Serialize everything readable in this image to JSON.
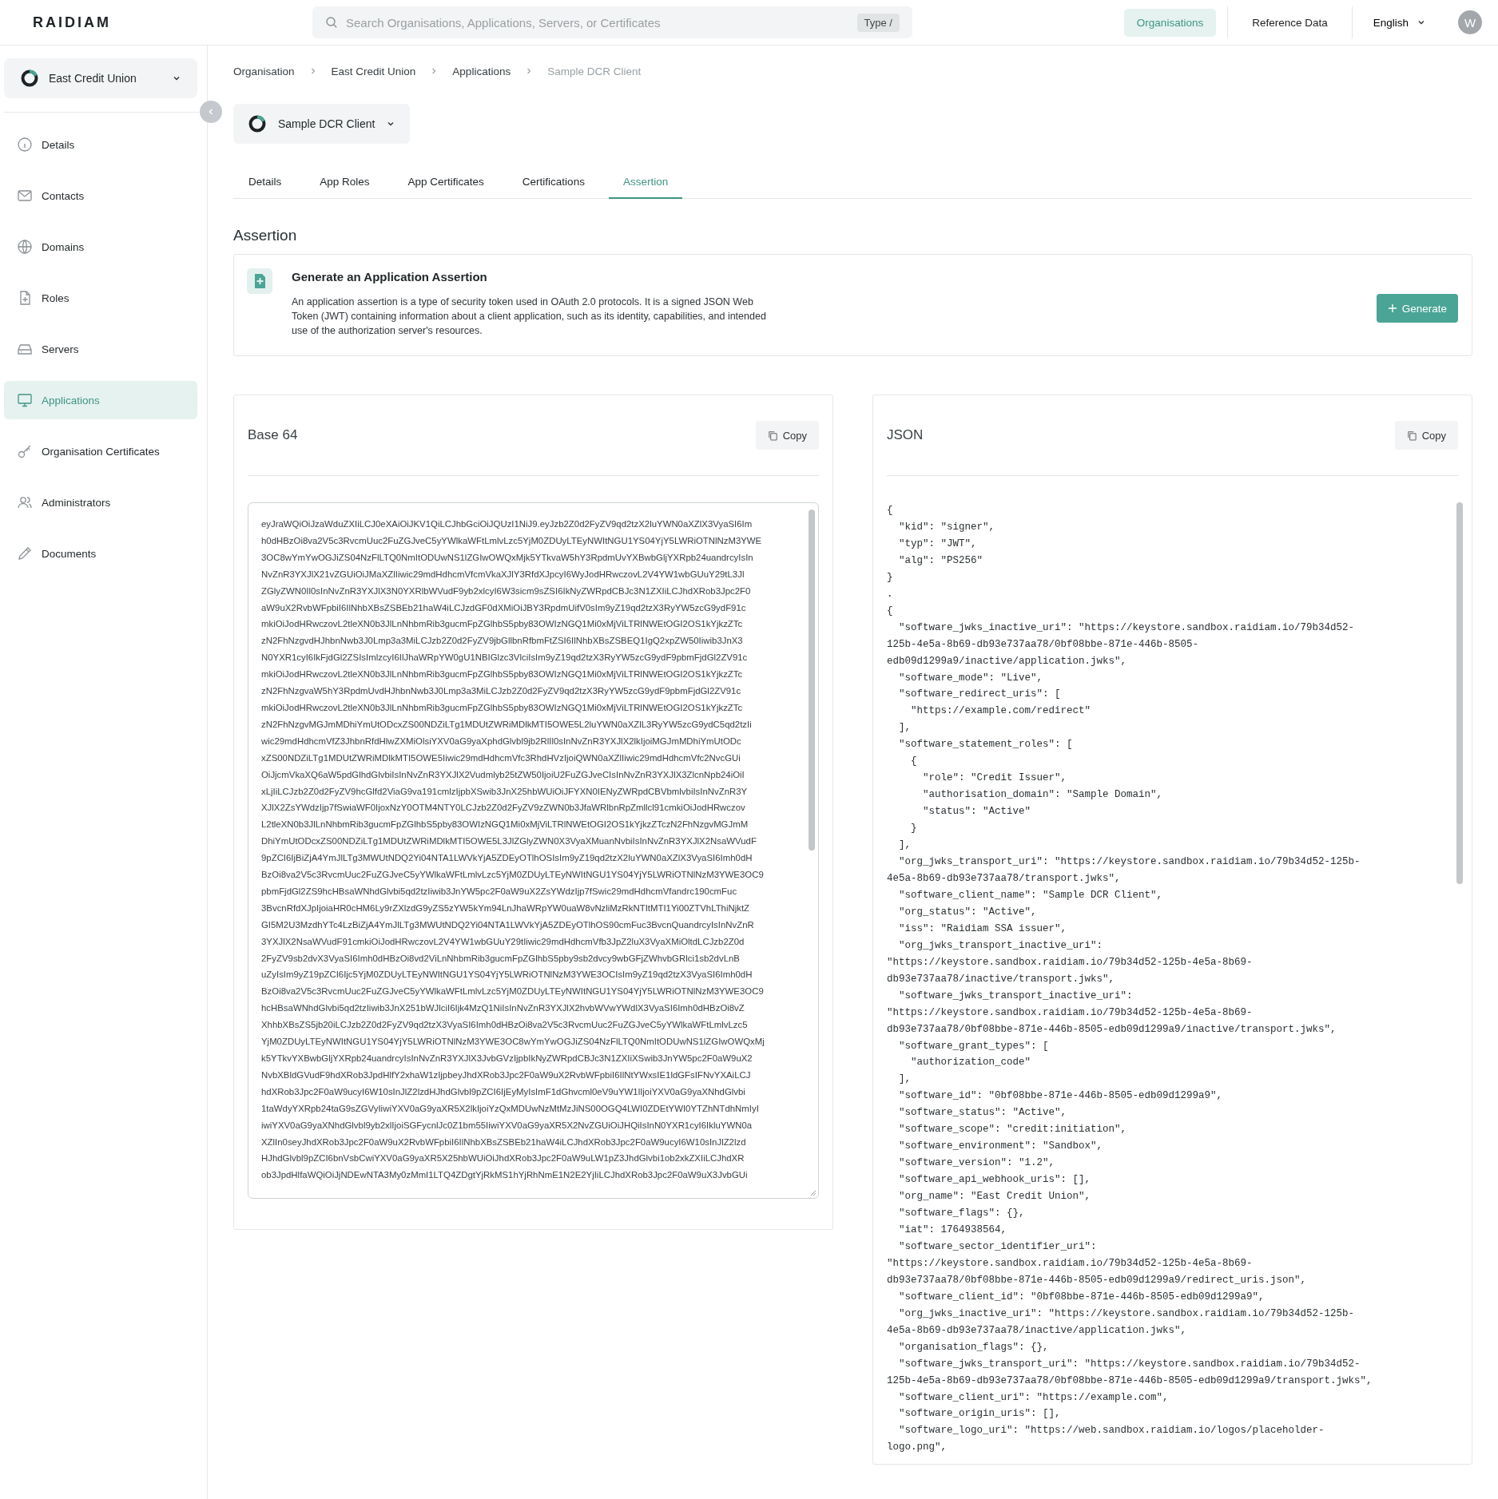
{
  "header": {
    "logo": "RAIDIAM",
    "search": {
      "placeholder": "Search Organisations, Applications, Servers, or Certificates",
      "shortcut": "Type /"
    },
    "nav": [
      {
        "label": "Organisations",
        "selected": true
      },
      {
        "label": "Reference Data",
        "selected": false
      }
    ],
    "language": "English",
    "avatar": "W"
  },
  "sidebar": {
    "organisation": "East Credit Union",
    "items": [
      {
        "label": "Details",
        "selected": false
      },
      {
        "label": "Contacts",
        "selected": false
      },
      {
        "label": "Domains",
        "selected": false
      },
      {
        "label": "Roles",
        "selected": false
      },
      {
        "label": "Servers",
        "selected": false
      },
      {
        "label": "Applications",
        "selected": true
      },
      {
        "label": "Organisation Certificates",
        "selected": false
      },
      {
        "label": "Administrators",
        "selected": false
      },
      {
        "label": "Documents",
        "selected": false
      }
    ]
  },
  "breadcrumb": [
    "Organisation",
    "East Credit Union",
    "Applications",
    "Sample DCR Client"
  ],
  "application": "Sample DCR Client",
  "tabs": [
    {
      "label": "Details",
      "selected": false
    },
    {
      "label": "App Roles",
      "selected": false
    },
    {
      "label": "App Certificates",
      "selected": false
    },
    {
      "label": "Certifications",
      "selected": false
    },
    {
      "label": "Assertion",
      "selected": true
    }
  ],
  "section_title": "Assertion",
  "generate_card": {
    "title": "Generate an Application Assertion",
    "description": "An application assertion is a type of security token used in OAuth 2.0 protocols. It is a signed JSON Web Token (JWT) containing information about a client application, such as its identity, capabilities, and intended use of the authorization server's resources.",
    "button": "Generate"
  },
  "base64_panel": {
    "title": "Base 64",
    "copy": "Copy",
    "lines": [
      "eyJraWQiOiJzaWduZXIiLCJ0eXAiOiJKV1QiLCJhbGciOiJQUzI1NiJ9.eyJzb2Z0d2FyZV9qd2tzX2luYWN0aXZlX3VyaSI6Im",
      "h0dHBzOi8va2V5c3RvcmUuc2FuZGJveC5yYWlkaWFtLmlvLzc5YjM0ZDUyLTEyNWItNGU1YS04YjY5LWRiOTNlNzM3YWE",
      "3OC8wYmYwOGJiZS04NzFlLTQ0NmItODUwNS1lZGIwOWQxMjk5YTkvaW5hY3RpdmUvYXBwbGljYXRpb24uandrcyIsIn",
      "NvZnR3YXJlX21vZGUiOiJMaXZlIiwic29mdHdhcmVfcmVkaXJlY3RfdXJpcyI6WyJodHRwczovL2V4YW1wbGUuY29tL3Jl",
      "ZGlyZWN0Il0sInNvZnR3YXJlX3N0YXRlbWVudF9yb2xlcyI6W3sicm9sZSI6IkNyZWRpdCBJc3N1ZXIiLCJhdXRob3Jpc2F0",
      "aW9uX2RvbWFpbiI6IlNhbXBsZSBEb21haW4iLCJzdGF0dXMiOiJBY3RpdmUifV0sIm9yZ19qd2tzX3RyYW5zcG9ydF91c",
      "mkiOiJodHRwczovL2tleXN0b3JlLnNhbmRib3gucmFpZGlhbS5pby83OWIzNGQ1Mi0xMjViLTRlNWEtOGI2OS1kYjkzZTc",
      "zN2FhNzgvdHJhbnNwb3J0Lmp3a3MiLCJzb2Z0d2FyZV9jbGllbnRfbmFtZSI6IlNhbXBsZSBEQ1IgQ2xpZW50Iiwib3JnX3",
      "N0YXR1cyI6IkFjdGl2ZSIsImlzcyI6IlJhaWRpYW0gU1NBIGlzc3VlciIsIm9yZ19qd2tzX3RyYW5zcG9ydF9pbmFjdGl2ZV91c",
      "mkiOiJodHRwczovL2tleXN0b3JlLnNhbmRib3gucmFpZGlhbS5pby83OWIzNGQ1Mi0xMjViLTRlNWEtOGI2OS1kYjkzZTc",
      "zN2FhNzgvaW5hY3RpdmUvdHJhbnNwb3J0Lmp3a3MiLCJzb2Z0d2FyZV9qd2tzX3RyYW5zcG9ydF9pbmFjdGl2ZV91c",
      "mkiOiJodHRwczovL2tleXN0b3JlLnNhbmRib3gucmFpZGlhbS5pby83OWIzNGQ1Mi0xMjViLTRlNWEtOGI2OS1kYjkzZTc",
      "zN2FhNzgvMGJmMDhiYmUtODcxZS00NDZiLTg1MDUtZWRiMDlkMTI5OWE5L2luYWN0aXZlL3RyYW5zcG9ydC5qd2tzIi",
      "wic29mdHdhcmVfZ3JhbnRfdHlwZXMiOlsiYXV0aG9yaXphdGlvbl9jb2RlIl0sInNvZnR3YXJlX2lkIjoiMGJmMDhiYmUtODc",
      "xZS00NDZiLTg1MDUtZWRiMDlkMTI5OWE5Iiwic29mdHdhcmVfc3RhdHVzIjoiQWN0aXZlIiwic29mdHdhcmVfc2NvcGUi",
      "OiJjcmVkaXQ6aW5pdGlhdGlvbiIsInNvZnR3YXJlX2Vudmlyb25tZW50IjoiU2FuZGJveCIsInNvZnR3YXJlX3ZlcnNpb24iOiI",
      "xLjIiLCJzb2Z0d2FyZV9hcGlfd2ViaG9va191cmlzIjpbXSwib3JnX25hbWUiOiJFYXN0IENyZWRpdCBVbmlvbiIsInNvZnR3Y",
      "XJlX2ZsYWdzIjp7fSwiaWF0IjoxNzY0OTM4NTY0LCJzb2Z0d2FyZV9zZWN0b3JfaWRlbnRpZmllcl91cmkiOiJodHRwczov",
      "L2tleXN0b3JlLnNhbmRib3gucmFpZGlhbS5pby83OWIzNGQ1Mi0xMjViLTRlNWEtOGI2OS1kYjkzZTczN2FhNzgvMGJmM",
      "DhiYmUtODcxZS00NDZiLTg1MDUtZWRiMDlkMTI5OWE5L3JlZGlyZWN0X3VyaXMuanNvbiIsInNvZnR3YXJlX2NsaWVudF",
      "9pZCI6IjBiZjA4YmJlLTg3MWUtNDQ2Yi04NTA1LWVkYjA5ZDEyOTlhOSIsIm9yZ19qd2tzX2luYWN0aXZlX3VyaSI6Imh0dH",
      "BzOi8va2V5c3RvcmUuc2FuZGJveC5yYWlkaWFtLmlvLzc5YjM0ZDUyLTEyNWItNGU1YS04YjY5LWRiOTNlNzM3YWE3OC9",
      "pbmFjdGl2ZS9hcHBsaWNhdGlvbi5qd2tzIiwib3JnYW5pc2F0aW9uX2ZsYWdzIjp7fSwic29mdHdhcmVfandrc190cmFuc",
      "3BvcnRfdXJpIjoiaHR0cHM6Ly9rZXlzdG9yZS5zYW5kYm94LnJhaWRpYW0uaW8vNzliMzRkNTItMTI1Yi00ZTVhLThiNjktZ",
      "GI5M2U3MzdhYTc4LzBiZjA4YmJlLTg3MWUtNDQ2Yi04NTA1LWVkYjA5ZDEyOTlhOS90cmFuc3BvcnQuandrcyIsInNvZnR",
      "3YXJlX2NsaWVudF91cmkiOiJodHRwczovL2V4YW1wbGUuY29tIiwic29mdHdhcmVfb3JpZ2luX3VyaXMiOltdLCJzb2Z0d",
      "2FyZV9sb2dvX3VyaSI6Imh0dHBzOi8vd2ViLnNhbmRib3gucmFpZGlhbS5pby9sb2dvcy9wbGFjZWhvbGRlci1sb2dvLnB",
      "uZyIsIm9yZ19pZCI6Ijc5YjM0ZDUyLTEyNWItNGU1YS04YjY5LWRiOTNlNzM3YWE3OCIsIm9yZ19qd2tzX3VyaSI6Imh0dH",
      "BzOi8va2V5c3RvcmUuc2FuZGJveC5yYWlkaWFtLmlvLzc5YjM0ZDUyLTEyNWItNGU1YS04YjY5LWRiOTNlNzM3YWE3OC9",
      "hcHBsaWNhdGlvbi5qd2tzIiwib3JnX251bWJlciI6Ijk4MzQ1NiIsInNvZnR3YXJlX2hvbWVwYWdlX3VyaSI6Imh0dHBzOi8vZ",
      "XhhbXBsZS5jb20iLCJzb2Z0d2FyZV9qd2tzX3VyaSI6Imh0dHBzOi8va2V5c3RvcmUuc2FuZGJveC5yYWlkaWFtLmlvLzc5",
      "YjM0ZDUyLTEyNWItNGU1YS04YjY5LWRiOTNlNzM3YWE3OC8wYmYwOGJiZS04NzFlLTQ0NmItODUwNS1lZGIwOWQxMj",
      "k5YTkvYXBwbGljYXRpb24uandrcyIsInNvZnR3YXJlX3JvbGVzIjpbIkNyZWRpdCBJc3N1ZXIiXSwib3JnYW5pc2F0aW9uX2",
      "NvbXBldGVudF9hdXRob3JpdHlfY2xhaW1zIjpbeyJhdXRob3Jpc2F0aW9uX2RvbWFpbiI6IlNtYWxsIE1ldGFsIFNvYXAiLCJ",
      "hdXRob3Jpc2F0aW9ucyI6W10sInJlZ2lzdHJhdGlvbl9pZCI6IjEyMyIsImF1dGhvcml0eV9uYW1lIjoiYXV0aG9yaXNhdGlvbi",
      "1taWdyYXRpb24taG9sZGVyIiwiYXV0aG9yaXR5X2lkIjoiYzQxMDUwNzMtMzJiNS00OGQ4LWI0ZDEtYWI0YTZhNTdhNmIyI",
      "iwiYXV0aG9yaXNhdGlvbl9yb2xlIjoiSGFycnlJc0Z1bm55IiwiYXV0aG9yaXR5X2NvZGUiOiJHQiIsInN0YXR1cyI6IkluYWN0a",
      "XZlIn0seyJhdXRob3Jpc2F0aW9uX2RvbWFpbiI6IlNhbXBsZSBEb21haW4iLCJhdXRob3Jpc2F0aW9ucyI6W10sInJlZ2lzd",
      "HJhdGlvbl9pZCI6bnVsbCwiYXV0aG9yaXR5X25hbWUiOiJhdXRob3Jpc2F0aW9uLW1pZ3JhdGlvbi1ob2xkZXIiLCJhdXR",
      "ob3JpdHlfaWQiOiJjNDEwNTA3My0zMmI1LTQ4ZDgtYjRkMS1hYjRhNmE1N2E2YjIiLCJhdXRob3Jpc2F0aW9uX3JvbGUi"
    ]
  },
  "json_panel": {
    "title": "JSON",
    "copy": "Copy",
    "lines": [
      "{",
      "  \"kid\": \"signer\",",
      "  \"typ\": \"JWT\",",
      "  \"alg\": \"PS256\"",
      "}",
      ".",
      "{",
      "  \"software_jwks_inactive_uri\": \"https://keystore.sandbox.raidiam.io/79b34d52-",
      "125b-4e5a-8b69-db93e737aa78/0bf08bbe-871e-446b-8505-",
      "edb09d1299a9/inactive/application.jwks\",",
      "  \"software_mode\": \"Live\",",
      "  \"software_redirect_uris\": [",
      "    \"https://example.com/redirect\"",
      "  ],",
      "  \"software_statement_roles\": [",
      "    {",
      "      \"role\": \"Credit Issuer\",",
      "      \"authorisation_domain\": \"Sample Domain\",",
      "      \"status\": \"Active\"",
      "    }",
      "  ],",
      "  \"org_jwks_transport_uri\": \"https://keystore.sandbox.raidiam.io/79b34d52-125b-",
      "4e5a-8b69-db93e737aa78/transport.jwks\",",
      "  \"software_client_name\": \"Sample DCR Client\",",
      "  \"org_status\": \"Active\",",
      "  \"iss\": \"Raidiam SSA issuer\",",
      "  \"org_jwks_transport_inactive_uri\":",
      "\"https://keystore.sandbox.raidiam.io/79b34d52-125b-4e5a-8b69-",
      "db93e737aa78/inactive/transport.jwks\",",
      "  \"software_jwks_transport_inactive_uri\":",
      "\"https://keystore.sandbox.raidiam.io/79b34d52-125b-4e5a-8b69-",
      "db93e737aa78/0bf08bbe-871e-446b-8505-edb09d1299a9/inactive/transport.jwks\",",
      "  \"software_grant_types\": [",
      "    \"authorization_code\"",
      "  ],",
      "  \"software_id\": \"0bf08bbe-871e-446b-8505-edb09d1299a9\",",
      "  \"software_status\": \"Active\",",
      "  \"software_scope\": \"credit:initiation\",",
      "  \"software_environment\": \"Sandbox\",",
      "  \"software_version\": \"1.2\",",
      "  \"software_api_webhook_uris\": [],",
      "  \"org_name\": \"East Credit Union\",",
      "  \"software_flags\": {},",
      "  \"iat\": 1764938564,",
      "  \"software_sector_identifier_uri\":",
      "\"https://keystore.sandbox.raidiam.io/79b34d52-125b-4e5a-8b69-",
      "db93e737aa78/0bf08bbe-871e-446b-8505-edb09d1299a9/redirect_uris.json\",",
      "  \"software_client_id\": \"0bf08bbe-871e-446b-8505-edb09d1299a9\",",
      "  \"org_jwks_inactive_uri\": \"https://keystore.sandbox.raidiam.io/79b34d52-125b-",
      "4e5a-8b69-db93e737aa78/inactive/application.jwks\",",
      "  \"organisation_flags\": {},",
      "  \"software_jwks_transport_uri\": \"https://keystore.sandbox.raidiam.io/79b34d52-",
      "125b-4e5a-8b69-db93e737aa78/0bf08bbe-871e-446b-8505-edb09d1299a9/transport.jwks\",",
      "  \"software_client_uri\": \"https://example.com\",",
      "  \"software_origin_uris\": [],",
      "  \"software_logo_uri\": \"https://web.sandbox.raidiam.io/logos/placeholder-",
      "logo.png\","
    ]
  }
}
